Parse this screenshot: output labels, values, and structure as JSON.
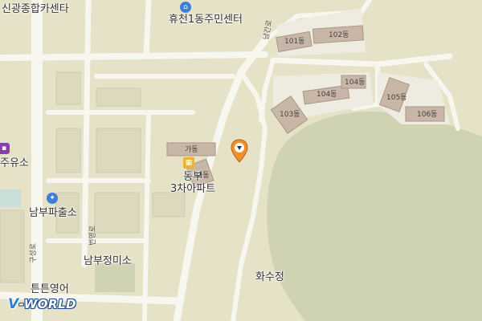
{
  "map": {
    "background_color": "#e6e2c7",
    "green_area_color": "#cfd2b3",
    "road_color": "#f7f6ef"
  },
  "labels": {
    "sinkwang_carcenter": "신광종합카센타",
    "hyucheon1_center": "휴천1동주민센터",
    "gas_station": "주유소",
    "nambu_police": "남부파출소",
    "nambu_barber": "남부정미소",
    "teunteun_english": "튼튼영어",
    "dongbu_apt": "동부\n3차아파트",
    "ga_dong": "가동",
    "na_dong": "나동",
    "hwasujeong": "화수정",
    "bldg_101": "101동",
    "bldg_102": "102동",
    "bldg_103": "103동",
    "bldg_104a": "104동",
    "bldg_104b": "104동",
    "bldg_105": "105동",
    "bldg_106": "106동"
  },
  "road_names": {
    "namgangro": "남간로",
    "beonyeongro": "번영로",
    "guseongro": "구성로"
  },
  "icons": {
    "home": "home-icon",
    "police": "police-icon",
    "bus": "bus-icon",
    "apartment": "apartment-icon",
    "marker": "location-pin-icon"
  },
  "logo": {
    "v": "V",
    "rest": "-WORLD"
  }
}
